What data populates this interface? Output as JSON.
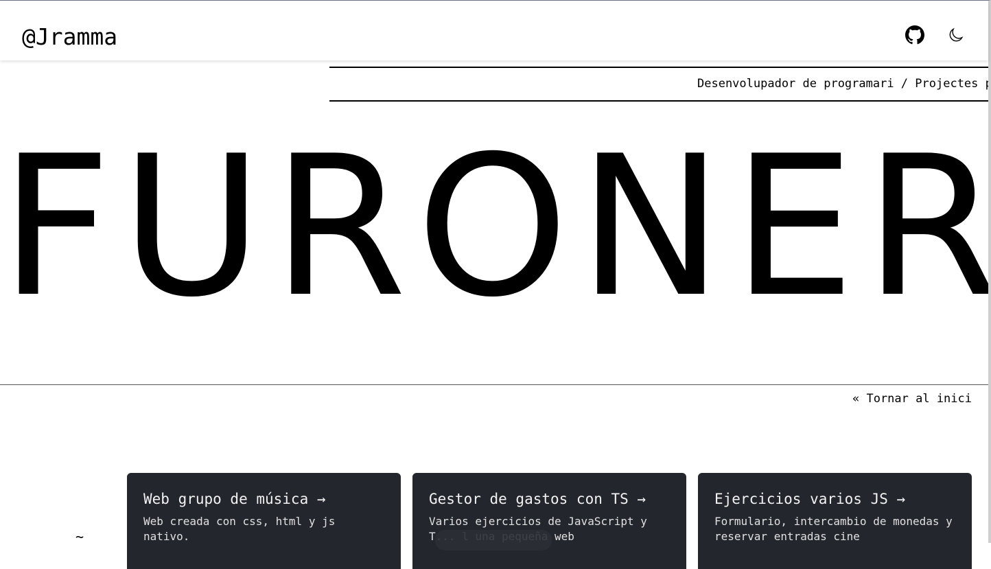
{
  "header": {
    "brand": "@Jramma",
    "github_icon": "github-icon",
    "theme_icon": "moon-icon"
  },
  "marquee": {
    "text": "Desenvolupador de programari / Projectes púb"
  },
  "hero": {
    "title": "FURONER"
  },
  "nav": {
    "back_label": "« Tornar al inici"
  },
  "cards": [
    {
      "title": "Web grupo de música →",
      "description": "Web creada con css, html y js nativo."
    },
    {
      "title": "Gestor de gastos con TS →",
      "description": "Varios ejercicios de JavaScript y T... l una pequeña web"
    },
    {
      "title": "Ejercicios varios JS →",
      "description": "Formulario, intercambio de monedas y reservar entradas cine"
    }
  ],
  "stray_glyph": "~",
  "colors": {
    "card_bg": "#23262d",
    "text": "#000000",
    "background": "#ffffff"
  }
}
